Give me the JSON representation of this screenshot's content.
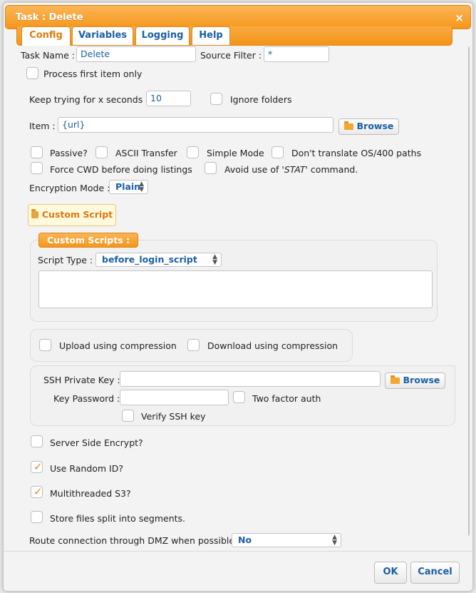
{
  "dialog": {
    "title": "Task : Delete",
    "close_glyph": "×"
  },
  "tabs": [
    {
      "label": "Config",
      "active": true
    },
    {
      "label": "Variables",
      "active": false
    },
    {
      "label": "Logging",
      "active": false
    },
    {
      "label": "Help",
      "active": false
    }
  ],
  "form": {
    "task_name_label": "Task Name :",
    "task_name_value": "Delete",
    "source_filter_label": "Source Filter :",
    "source_filter_value": "*",
    "process_first_label": "Process first item only",
    "keep_trying_label": "Keep trying for x seconds :",
    "keep_trying_value": "10",
    "ignore_folders_label": "Ignore folders",
    "item_label": "Item :",
    "item_value": "{url}",
    "browse_label": "Browse",
    "passive_label": "Passive?",
    "ascii_label": "ASCII Transfer",
    "simple_mode_label": "Simple Mode",
    "dont_translate_label": "Don't translate OS/400 paths",
    "force_cwd_label": "Force CWD before doing listings",
    "avoid_stat_prefix": "Avoid use of '",
    "avoid_stat_italic": "STAT",
    "avoid_stat_suffix": "' command.",
    "encryption_label": "Encryption Mode :",
    "encryption_value": "Plain",
    "custom_script_button": "Custom Script",
    "custom_scripts_legend": "Custom Scripts :",
    "script_type_label": "Script Type :",
    "script_type_value": "before_login_script",
    "upload_compression_label": "Upload using compression",
    "download_compression_label": "Download using compression",
    "ssh_key_label": "SSH Private Key :",
    "ssh_browse_label": "Browse",
    "key_password_label": "Key Password :",
    "two_factor_label": "Two factor auth",
    "verify_ssh_label": "Verify SSH key",
    "server_side_encrypt_label": "Server Side Encrypt?",
    "random_id_label": "Use Random ID?",
    "multithreaded_label": "Multithreaded S3?",
    "split_segments_label": "Store files split into segments.",
    "route_dmz_label": "Route connection through DMZ when possible :",
    "route_dmz_value": "No"
  },
  "checkbox_states": {
    "process_first": false,
    "ignore_folders": false,
    "passive": false,
    "ascii": false,
    "simple_mode": false,
    "dont_translate": false,
    "force_cwd": false,
    "avoid_stat": false,
    "upload_compression": false,
    "download_compression": false,
    "two_factor": false,
    "verify_ssh": false,
    "server_side_encrypt": false,
    "random_id": true,
    "multithreaded": true,
    "split_segments": false
  },
  "footer": {
    "ok_label": "OK",
    "cancel_label": "Cancel"
  },
  "colors": {
    "accent": "#f5971b",
    "link_blue": "#1b5fa6",
    "tick_orange": "#e8841a"
  }
}
